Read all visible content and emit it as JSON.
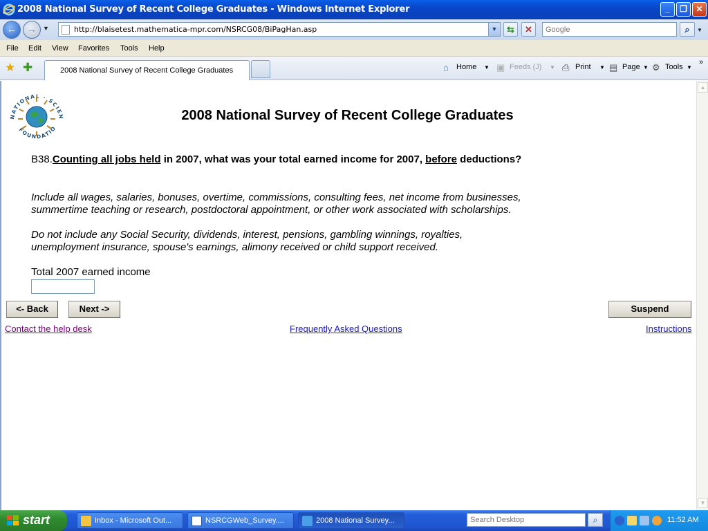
{
  "window": {
    "title": "2008 National Survey of Recent College Graduates - Windows Internet Explorer",
    "minimize": "_",
    "restore": "❐",
    "close": "✕"
  },
  "address_bar": {
    "url": "http://blaisetest.mathematica-mpr.com/NSRCG08/BiPagHan.asp",
    "search_placeholder": "Google"
  },
  "menu": [
    "File",
    "Edit",
    "View",
    "Favorites",
    "Tools",
    "Help"
  ],
  "tabs": [
    {
      "label": "2008 National Survey of Recent College Graduates",
      "active": true
    }
  ],
  "command_bar": {
    "home": "Home",
    "feeds": "Feeds (J)",
    "print": "Print",
    "page": "Page",
    "tools": "Tools",
    "more": "»"
  },
  "page": {
    "logo_text": "NATIONAL SCIENCE FOUNDATION",
    "title": "2008 National Survey of Recent College Graduates",
    "question": {
      "number": "B38.",
      "part1": "Counting all jobs held",
      "part2": " in 2007, what was your total earned income for 2007, ",
      "part3": "before",
      "part4": " deductions?"
    },
    "include_text": "Include all wages, salaries, bonuses, overtime, commissions, consulting fees, net income from businesses, summertime teaching or research, postdoctoral appointment, or other work associated with scholarships.",
    "exclude_text": "Do not include any Social Security, dividends, interest, pensions, gambling winnings, royalties, unemployment insurance, spouse's earnings, alimony received or child support received.",
    "input_label": "Total 2007 earned income",
    "input_value": "",
    "back_label": "<- Back",
    "next_label": "Next ->",
    "suspend_label": "Suspend",
    "help_link": "Contact the help desk",
    "faq_link": "Frequently Asked Questions",
    "instructions_link": "Instructions"
  },
  "taskbar": {
    "start": "start",
    "tasks": [
      {
        "label": "Inbox - Microsoft Out...",
        "active": false
      },
      {
        "label": "NSRCGWeb_Survey....",
        "active": false
      },
      {
        "label": "2008 National Survey...",
        "active": true
      }
    ],
    "search_placeholder": "Search Desktop",
    "clock": "11:52 AM"
  }
}
